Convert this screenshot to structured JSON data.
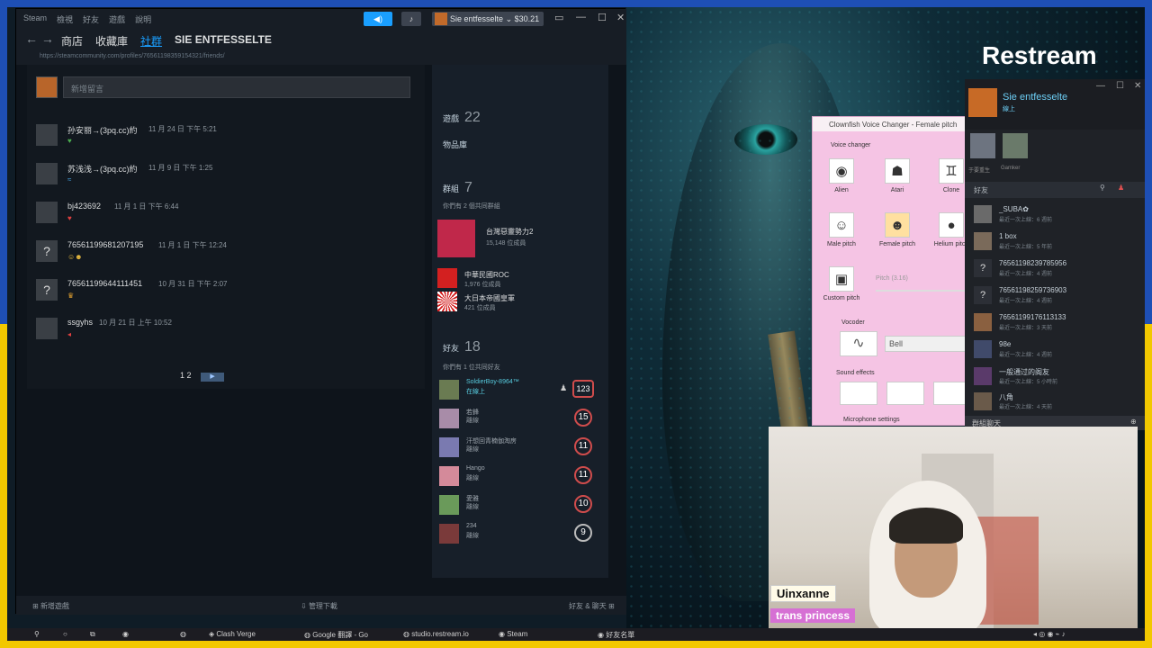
{
  "colors": {
    "accent": "#1a9fff",
    "online": "#6dcff6",
    "level_red": "#d04c4c"
  },
  "restream": "Restream",
  "titlebar": {
    "menu": [
      "Steam",
      "檢視",
      "好友",
      "遊戲",
      "說明"
    ],
    "user": "Sie entfesselte",
    "balance": "$30.21"
  },
  "nav": {
    "links": [
      "商店",
      "收藏庫",
      "社群",
      "SIE ENTFESSELTE"
    ],
    "url": "https://steamcommunity.com/profiles/76561198359154321/friends/"
  },
  "comments": {
    "placeholder": "新增留言",
    "items": [
      {
        "name": "孙安丽→(3pq.cc)約",
        "time": "11 月 24 日 下午 5:21",
        "msg_icon": "green-heart-icon"
      },
      {
        "name": "苏浅浅→(3pq.cc)約",
        "time": "11 月 9 日 下午 1:25",
        "msg_icon": "wave-icon"
      },
      {
        "name": "bj423692",
        "time": "11 月 1 日 下午 6:44",
        "msg_icon": "red-heart-icon"
      },
      {
        "name": "76561199681207195",
        "time": "11 月 1 日 下午 12:24",
        "msg_icon": "emoji-icon"
      },
      {
        "name": "76561199644111451",
        "time": "10 月 31 日 下午 2:07",
        "msg_icon": "trophy-icon"
      },
      {
        "name": "ssgyhs",
        "time": "10 月 21 日 上午 10:52",
        "msg_icon": "flag-icon"
      }
    ],
    "pager": "1 2"
  },
  "sidebar": {
    "games_label": "遊戲",
    "games_count": "22",
    "inventory": "物品庫",
    "groups_label": "群組",
    "groups_count": "7",
    "groups_common": "你們有 2 個共同群組",
    "groups": [
      {
        "name": "台灣惡靈勢力2",
        "members": "15,148 位成員"
      },
      {
        "name": "中華民國ROC",
        "members": "1,976 位成員"
      },
      {
        "name": "大日本帝國皇軍",
        "members": "421 位成員"
      }
    ],
    "friends_label": "好友",
    "friends_count": "18",
    "friends_common": "你們有 1 位共同好友",
    "friends": [
      {
        "name": "SoldierBoy-8964™",
        "status": "在線上",
        "level": "123"
      },
      {
        "name": "若鋒",
        "status": "離線",
        "level": "15"
      },
      {
        "name": "汗想回青楠伽淘房",
        "status": "離線",
        "level": "11"
      },
      {
        "name": "Hango",
        "status": "離線",
        "level": "11"
      },
      {
        "name": "愛雅",
        "status": "離線",
        "level": "10"
      },
      {
        "name": "234",
        "status": "離線",
        "level": "9"
      }
    ]
  },
  "footer": {
    "left": "新增遊戲",
    "middle": "管理下載",
    "right": "好友 & 聊天"
  },
  "clownfish": {
    "title": "Clownfish Voice Changer - Female pitch",
    "voice_changer": "Voice changer",
    "effects": [
      "Alien",
      "Atari",
      "Clone",
      "Male pitch",
      "Female pitch",
      "Helium pitch",
      "Custom pitch"
    ],
    "pitch_label": "Pitch (3.16)",
    "vocoder": "Vocoder",
    "bell": "Bell",
    "sound_effects": "Sound effects",
    "mic_settings": "Microphone settings"
  },
  "friendlist": {
    "user": "Sie entfesselte",
    "status": "線上",
    "games": [
      "于要重生",
      "Gamker"
    ],
    "section": "好友",
    "friends": [
      {
        "name": "_SUBA✿",
        "status": "最近一次上線：6 週前"
      },
      {
        "name": "1 box",
        "status": "最近一次上線：5 年前"
      },
      {
        "name": "76561198239785956",
        "status": "最近一次上線：4 週前"
      },
      {
        "name": "76561198259736903",
        "status": "最近一次上線：4 週前"
      },
      {
        "name": "76561199176113133",
        "status": "最近一次上線：3 天前"
      },
      {
        "name": "98e",
        "status": "最近一次上線：4 週前"
      },
      {
        "name": "一般通过的阁友",
        "status": "最近一次上線：5 小時前"
      },
      {
        "name": "八角",
        "status": "最近一次上線：4 天前"
      }
    ],
    "group_chat": "群組聊天"
  },
  "stream": {
    "name": "Uinxanne",
    "tag": "trans princess"
  },
  "taskbar": {
    "items": [
      "Clash Verge",
      "Google 翻譯 - Go",
      "studio.restream.io",
      "Steam",
      "好友名單"
    ]
  }
}
